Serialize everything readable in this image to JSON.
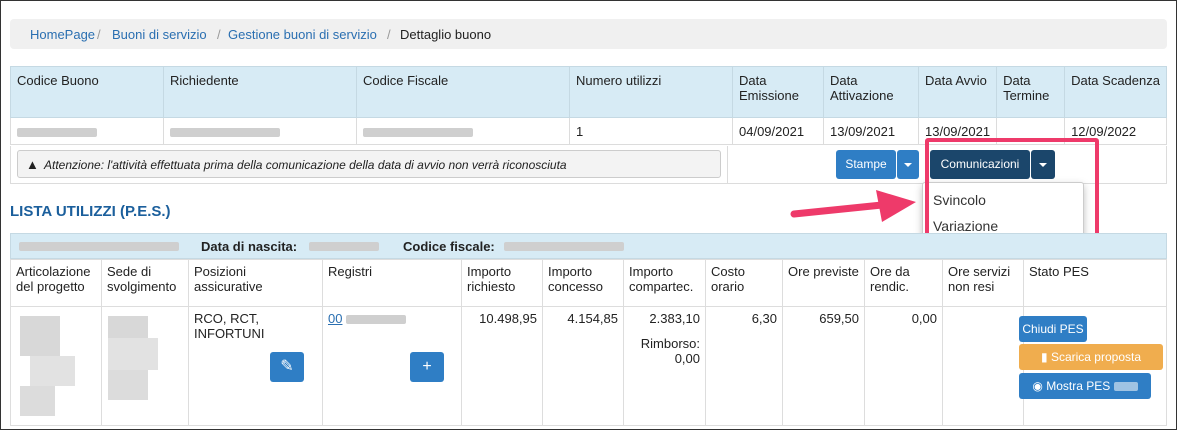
{
  "breadcrumb": {
    "items": [
      "HomePage",
      "Buoni di servizio",
      "Gestione buoni di servizio"
    ],
    "current": "Dettaglio buono",
    "separator": "/"
  },
  "voucher_table": {
    "headers": [
      "Codice Buono",
      "Richiedente",
      "Codice Fiscale",
      "Numero utilizzi",
      "Data Emissione",
      "Data Attivazione",
      "Data Avvio",
      "Data Termine",
      "Data Scadenza"
    ],
    "row": {
      "numero_utilizzi": "1",
      "data_emissione": "04/09/2021",
      "data_attivazione": "13/09/2021",
      "data_avvio": "13/09/2021",
      "data_termine": "",
      "data_scadenza": "12/09/2022"
    }
  },
  "warning": {
    "icon": "warning-triangle-icon",
    "text": "Attenzione: l'attività effettuata prima della comunicazione della data di avvio non verrà riconosciuta"
  },
  "actions": {
    "stampe_label": "Stampe",
    "comunicazioni_label": "Comunicazioni",
    "dropdown_items": [
      "Svincolo",
      "Variazione"
    ]
  },
  "section": {
    "title": "LISTA UTILIZZI (P.E.S.)"
  },
  "pes_header": {
    "birth_label": "Data di nascita:",
    "cf_label": "Codice fiscale:"
  },
  "pes_table": {
    "headers": [
      "Articolazione del progetto",
      "Sede di svolgimento",
      "Posizioni assicurative",
      "Registri",
      "Importo richiesto",
      "Importo concesso",
      "Importo compartec.",
      "Costo orario",
      "Ore previste",
      "Ore da rendic.",
      "Ore servizi non resi",
      "Stato PES"
    ],
    "row": {
      "posizioni": "RCO, RCT, INFORTUNI",
      "registro_link": "00",
      "importo_richiesto": "10.498,95",
      "importo_concesso": "4.154,85",
      "importo_compartec": "2.383,10",
      "rimborso_label": "Rimborso:",
      "rimborso_value": "0,00",
      "costo_orario": "6,30",
      "ore_previste": "659,50",
      "ore_da_rendic": "0,00",
      "ore_servizi_non_resi": ""
    },
    "buttons": {
      "chiudi": "Chiudi PES",
      "scarica": "Scarica proposta",
      "mostra": "Mostra PES"
    }
  },
  "colors": {
    "link": "#2a6fb1",
    "header_bg": "#d7ebf5",
    "primary": "#2f7ec5",
    "dark_primary": "#1b466b",
    "warning_btn": "#f0ad4e",
    "highlight": "#ee3a6a"
  }
}
